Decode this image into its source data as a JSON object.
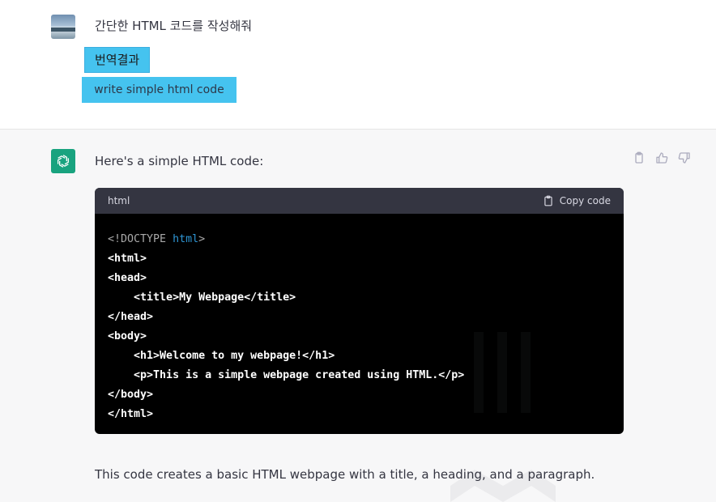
{
  "user_message": {
    "text": "간단한 HTML 코드를 작성해줘",
    "translation_label": "번역결과",
    "translation_text": "write simple html code"
  },
  "assistant_message": {
    "intro": "Here's a simple HTML code:",
    "code_block": {
      "language": "html",
      "copy_label": "Copy code",
      "lines": [
        {
          "indent": "",
          "segments": [
            {
              "t": "<!DOCTYPE ",
              "c": "gray"
            },
            {
              "t": "html",
              "c": "blue"
            },
            {
              "t": ">",
              "c": "gray"
            }
          ]
        },
        {
          "indent": "",
          "segments": [
            {
              "t": "<html>",
              "c": ""
            }
          ]
        },
        {
          "indent": "",
          "segments": [
            {
              "t": "<head>",
              "c": ""
            }
          ]
        },
        {
          "indent": "    ",
          "segments": [
            {
              "t": "<title>My Webpage</title>",
              "c": ""
            }
          ]
        },
        {
          "indent": "",
          "segments": [
            {
              "t": "</head>",
              "c": ""
            }
          ]
        },
        {
          "indent": "",
          "segments": [
            {
              "t": "<body>",
              "c": ""
            }
          ]
        },
        {
          "indent": "    ",
          "segments": [
            {
              "t": "<h1>Welcome to my webpage!</h1>",
              "c": ""
            }
          ]
        },
        {
          "indent": "    ",
          "segments": [
            {
              "t": "<p>This is a simple webpage created using HTML.</p>",
              "c": ""
            }
          ]
        },
        {
          "indent": "",
          "segments": [
            {
              "t": "</body>",
              "c": ""
            }
          ]
        },
        {
          "indent": "",
          "segments": [
            {
              "t": "</html>",
              "c": ""
            }
          ]
        }
      ]
    },
    "outro": "This code creates a basic HTML webpage with a title, a heading, and a paragraph."
  },
  "colors": {
    "accent_bot": "#19a37f",
    "translation_highlight": "#45c3ef",
    "code_header_bg": "#343541",
    "code_bg": "#000000"
  },
  "icons": [
    "user-avatar",
    "openai-logo-icon",
    "clipboard-icon",
    "thumbs-up-icon",
    "thumbs-down-icon"
  ]
}
